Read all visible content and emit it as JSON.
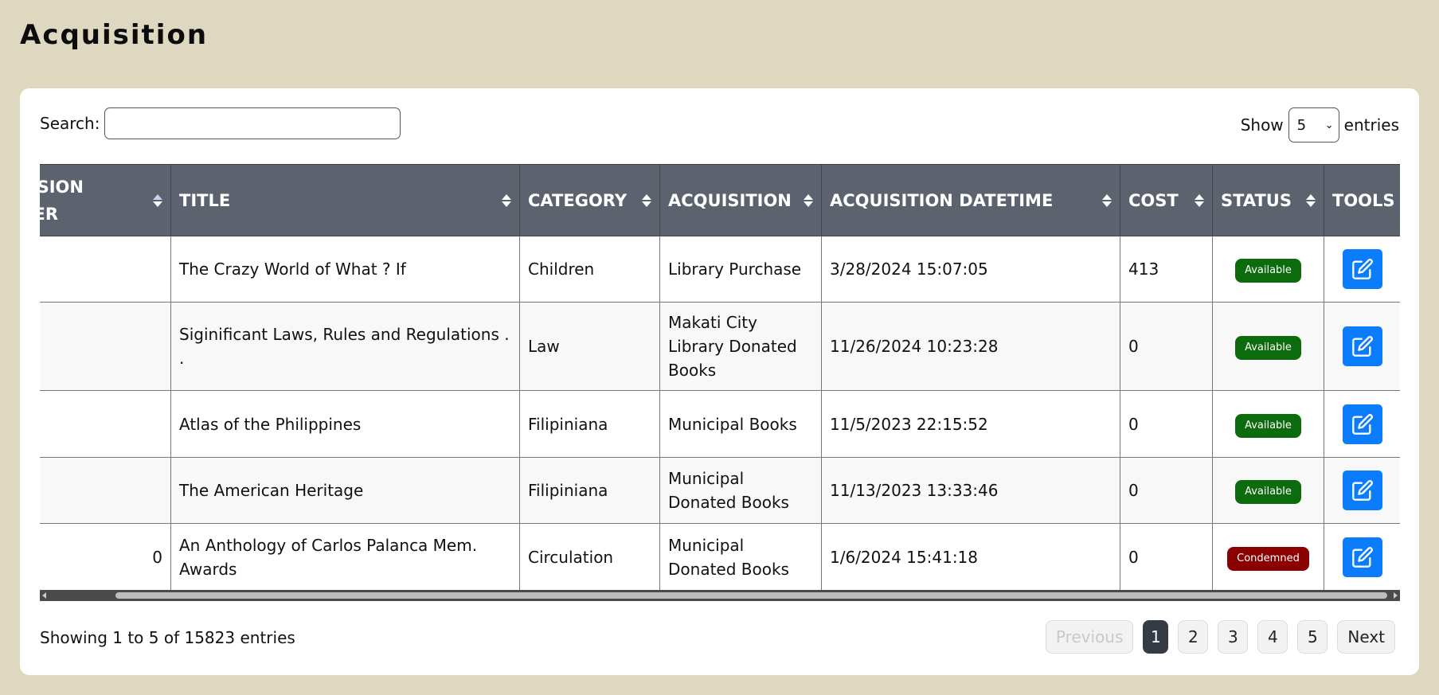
{
  "page": {
    "title": "Acquisition"
  },
  "search": {
    "label": "Search:",
    "value": "",
    "placeholder": ""
  },
  "show": {
    "prefix": "Show",
    "value": "5",
    "suffix": "entries"
  },
  "table": {
    "headers": {
      "accession_line1": "ACCESSION",
      "accession_line2": "NUMBER",
      "title": "TITLE",
      "category": "CATEGORY",
      "acquisition": "ACQUISITION",
      "acquisition_datetime": "ACQUISITION DATETIME",
      "cost": "COST",
      "status": "STATUS",
      "tools": "TOOLS"
    },
    "rows": [
      {
        "accession": "",
        "title": "The Crazy World of What ? If",
        "category": "Children",
        "acquisition": "Library Purchase",
        "datetime": "3/28/2024 15:07:05",
        "cost": "413",
        "status": "Available"
      },
      {
        "accession": "",
        "title": "Siginificant Laws, Rules and Regulations . .",
        "category": "Law",
        "acquisition": "Makati City Library Donated Books",
        "datetime": "11/26/2024 10:23:28",
        "cost": "0",
        "status": "Available"
      },
      {
        "accession": "",
        "title": "Atlas of the Philippines",
        "category": "Filipiniana",
        "acquisition": "Municipal Books",
        "datetime": "11/5/2023 22:15:52",
        "cost": "0",
        "status": "Available"
      },
      {
        "accession": "",
        "title": "The American Heritage",
        "category": "Filipiniana",
        "acquisition": "Municipal Donated Books",
        "datetime": "11/13/2023 13:33:46",
        "cost": "0",
        "status": "Available"
      },
      {
        "accession": "0",
        "title": "An Anthology of Carlos Palanca Mem. Awards",
        "category": "Circulation",
        "acquisition": "Municipal Donated Books",
        "datetime": "1/6/2024 15:41:18",
        "cost": "0",
        "status": "Condemned"
      }
    ]
  },
  "status_colors": {
    "Available": "#0c6b0c",
    "Condemned": "#8b0000"
  },
  "edit_icon": "edit-icon",
  "footer": {
    "info": "Showing 1 to 5 of 15823 entries"
  },
  "pagination": {
    "previous": "Previous",
    "pages": [
      "1",
      "2",
      "3",
      "4",
      "5"
    ],
    "active": "1",
    "next": "Next"
  }
}
